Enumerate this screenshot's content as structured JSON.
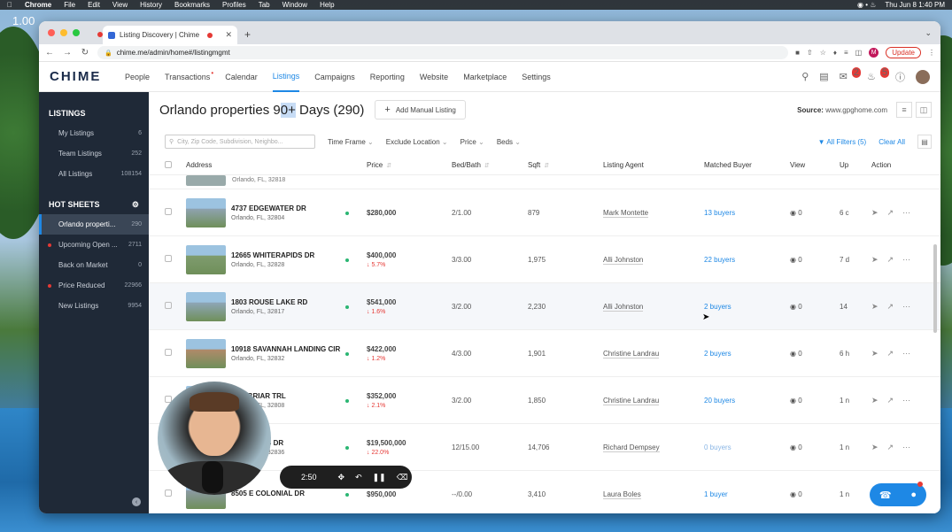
{
  "screen": {
    "zoom": "1.00",
    "menubar": [
      "Chrome",
      "File",
      "Edit",
      "View",
      "History",
      "Bookmarks",
      "Profiles",
      "Tab",
      "Window",
      "Help"
    ],
    "clock": "Thu Jun 8  1:40 PM"
  },
  "browser": {
    "tab_title": "Listing Discovery | Chime",
    "url": "chime.me/admin/home#/listingmgmt",
    "update_label": "Update",
    "profile_initial": "M"
  },
  "app": {
    "logo": "CHIME",
    "nav": [
      "People",
      "Transactions",
      "Calendar",
      "Listings",
      "Campaigns",
      "Reporting",
      "Website",
      "Marketplace",
      "Settings"
    ],
    "active_nav": "Listings",
    "badges": {
      "inbox": "2",
      "bell": "5"
    }
  },
  "sidebar": {
    "listings_title": "LISTINGS",
    "listings": [
      {
        "label": "My Listings",
        "count": "6"
      },
      {
        "label": "Team Listings",
        "count": "252"
      },
      {
        "label": "All Listings",
        "count": "108154"
      }
    ],
    "hot_title": "HOT SHEETS",
    "hot": [
      {
        "label": "Orlando properti...",
        "count": "290"
      },
      {
        "label": "Upcoming Open ...",
        "count": "2711"
      },
      {
        "label": "Back on Market",
        "count": "0"
      },
      {
        "label": "Price Reduced",
        "count": "22966"
      },
      {
        "label": "New Listings",
        "count": "9954"
      }
    ]
  },
  "header": {
    "title_pre": "Orlando properties 9",
    "title_hl": "0+",
    "title_post": " Days (290)",
    "add_button": "Add Manual Listing",
    "source_label": "Source:",
    "source_value": "www.gpghome.com"
  },
  "filters": {
    "search_placeholder": "City, Zip Code, Subdivision, Neighbo...",
    "items": [
      "Time Frame",
      "Exclude Location",
      "Price",
      "Beds"
    ],
    "all_filters": "All Filters (5)",
    "clear_all": "Clear All"
  },
  "table": {
    "columns": [
      "Address",
      "Price",
      "Bed/Bath",
      "Sqft",
      "Listing Agent",
      "Matched Buyer",
      "View",
      "Up",
      "Action"
    ],
    "partial_city": "Orlando, FL, 32818",
    "rows": [
      {
        "street": "4737 EDGEWATER DR",
        "city": "Orlando, FL, 32804",
        "price": "$280,000",
        "change": "",
        "bedbath": "2/1.00",
        "sqft": "879",
        "agent": "Mark Montette",
        "buyers": "13 buyers",
        "view": "0",
        "up": "6 c"
      },
      {
        "street": "12665 WHITERAPIDS DR",
        "city": "Orlando, FL, 32828",
        "price": "$400,000",
        "change": "5.7%",
        "bedbath": "3/3.00",
        "sqft": "1,975",
        "agent": "Alli Johnston",
        "buyers": "22 buyers",
        "view": "0",
        "up": "7 d"
      },
      {
        "street": "1803 ROUSE LAKE RD",
        "city": "Orlando, FL, 32817",
        "price": "$541,000",
        "change": "1.6%",
        "bedbath": "3/2.00",
        "sqft": "2,230",
        "agent": "Alli Johnston",
        "buyers": "2 buyers",
        "view": "0",
        "up": "14"
      },
      {
        "street": "10918 SAVANNAH LANDING CIR",
        "city": "Orlando, FL, 32832",
        "price": "$422,000",
        "change": "1.2%",
        "bedbath": "4/3.00",
        "sqft": "1,901",
        "agent": "Christine Landrau",
        "buyers": "2 buyers",
        "view": "0",
        "up": "6 h"
      },
      {
        "street": "FOX BRIAR TRL",
        "city": "Orlando, FL, 32808",
        "price": "$352,000",
        "change": "2.1%",
        "bedbath": "3/2.00",
        "sqft": "1,850",
        "agent": "Christine Landrau",
        "buyers": "20 buyers",
        "view": "0",
        "up": "1 n"
      },
      {
        "street": "T CYPRESS DR",
        "city": "Orlando, FL, 32836",
        "price": "$19,500,000",
        "change": "22.0%",
        "bedbath": "12/15.00",
        "sqft": "14,706",
        "agent": "Richard Dempsey",
        "buyers": "0 buyers",
        "view": "0",
        "up": "1 n"
      },
      {
        "street": "8505 E COLONIAL DR",
        "city": "",
        "price": "$950,000",
        "change": "",
        "bedbath": "--/0.00",
        "sqft": "3,410",
        "agent": "Laura Boles",
        "buyers": "1 buyer",
        "view": "0",
        "up": "1 n"
      }
    ]
  },
  "recorder": {
    "time": "2:50"
  }
}
